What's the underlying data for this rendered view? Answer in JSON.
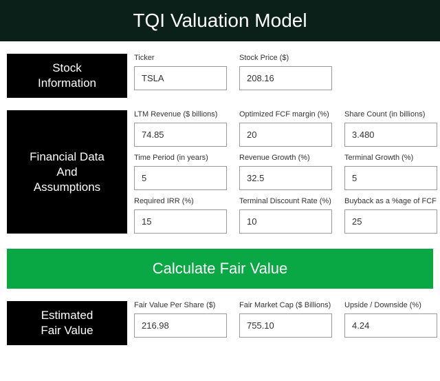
{
  "title": "TQI Valuation Model",
  "stockInfo": {
    "heading": "Stock\nInformation",
    "ticker": {
      "label": "Ticker",
      "value": "TSLA"
    },
    "price": {
      "label": "Stock Price ($)",
      "value": "208.16"
    }
  },
  "financial": {
    "heading": "Financial Data\nAnd\nAssumptions",
    "ltmRevenue": {
      "label": "LTM Revenue ($ billions)",
      "value": "74.85"
    },
    "fcfMargin": {
      "label": "Optimized FCF margin (%)",
      "value": "20"
    },
    "shareCount": {
      "label": "Share Count (in billions)",
      "value": "3.480"
    },
    "timePeriod": {
      "label": "Time Period (in years)",
      "value": "5"
    },
    "revenueGrowth": {
      "label": "Revenue Growth (%)",
      "value": "32.5"
    },
    "terminalGrowth": {
      "label": "Terminal Growth (%)",
      "value": "5"
    },
    "requiredIrr": {
      "label": "Required IRR (%)",
      "value": "15"
    },
    "terminalDiscount": {
      "label": "Terminal Discount Rate (%)",
      "value": "10"
    },
    "buyback": {
      "label": "Buyback as a %age of FCF",
      "value": "25"
    }
  },
  "calcButton": "Calculate Fair Value",
  "estimated": {
    "heading": "Estimated\nFair Value",
    "fairValuePerShare": {
      "label": "Fair Value Per Share ($)",
      "value": "216.98"
    },
    "fairMarketCap": {
      "label": "Fair Market Cap ($ Billions)",
      "value": "755.10"
    },
    "upsideDownside": {
      "label": "Upside / Downside (%)",
      "value": "4.24"
    }
  }
}
